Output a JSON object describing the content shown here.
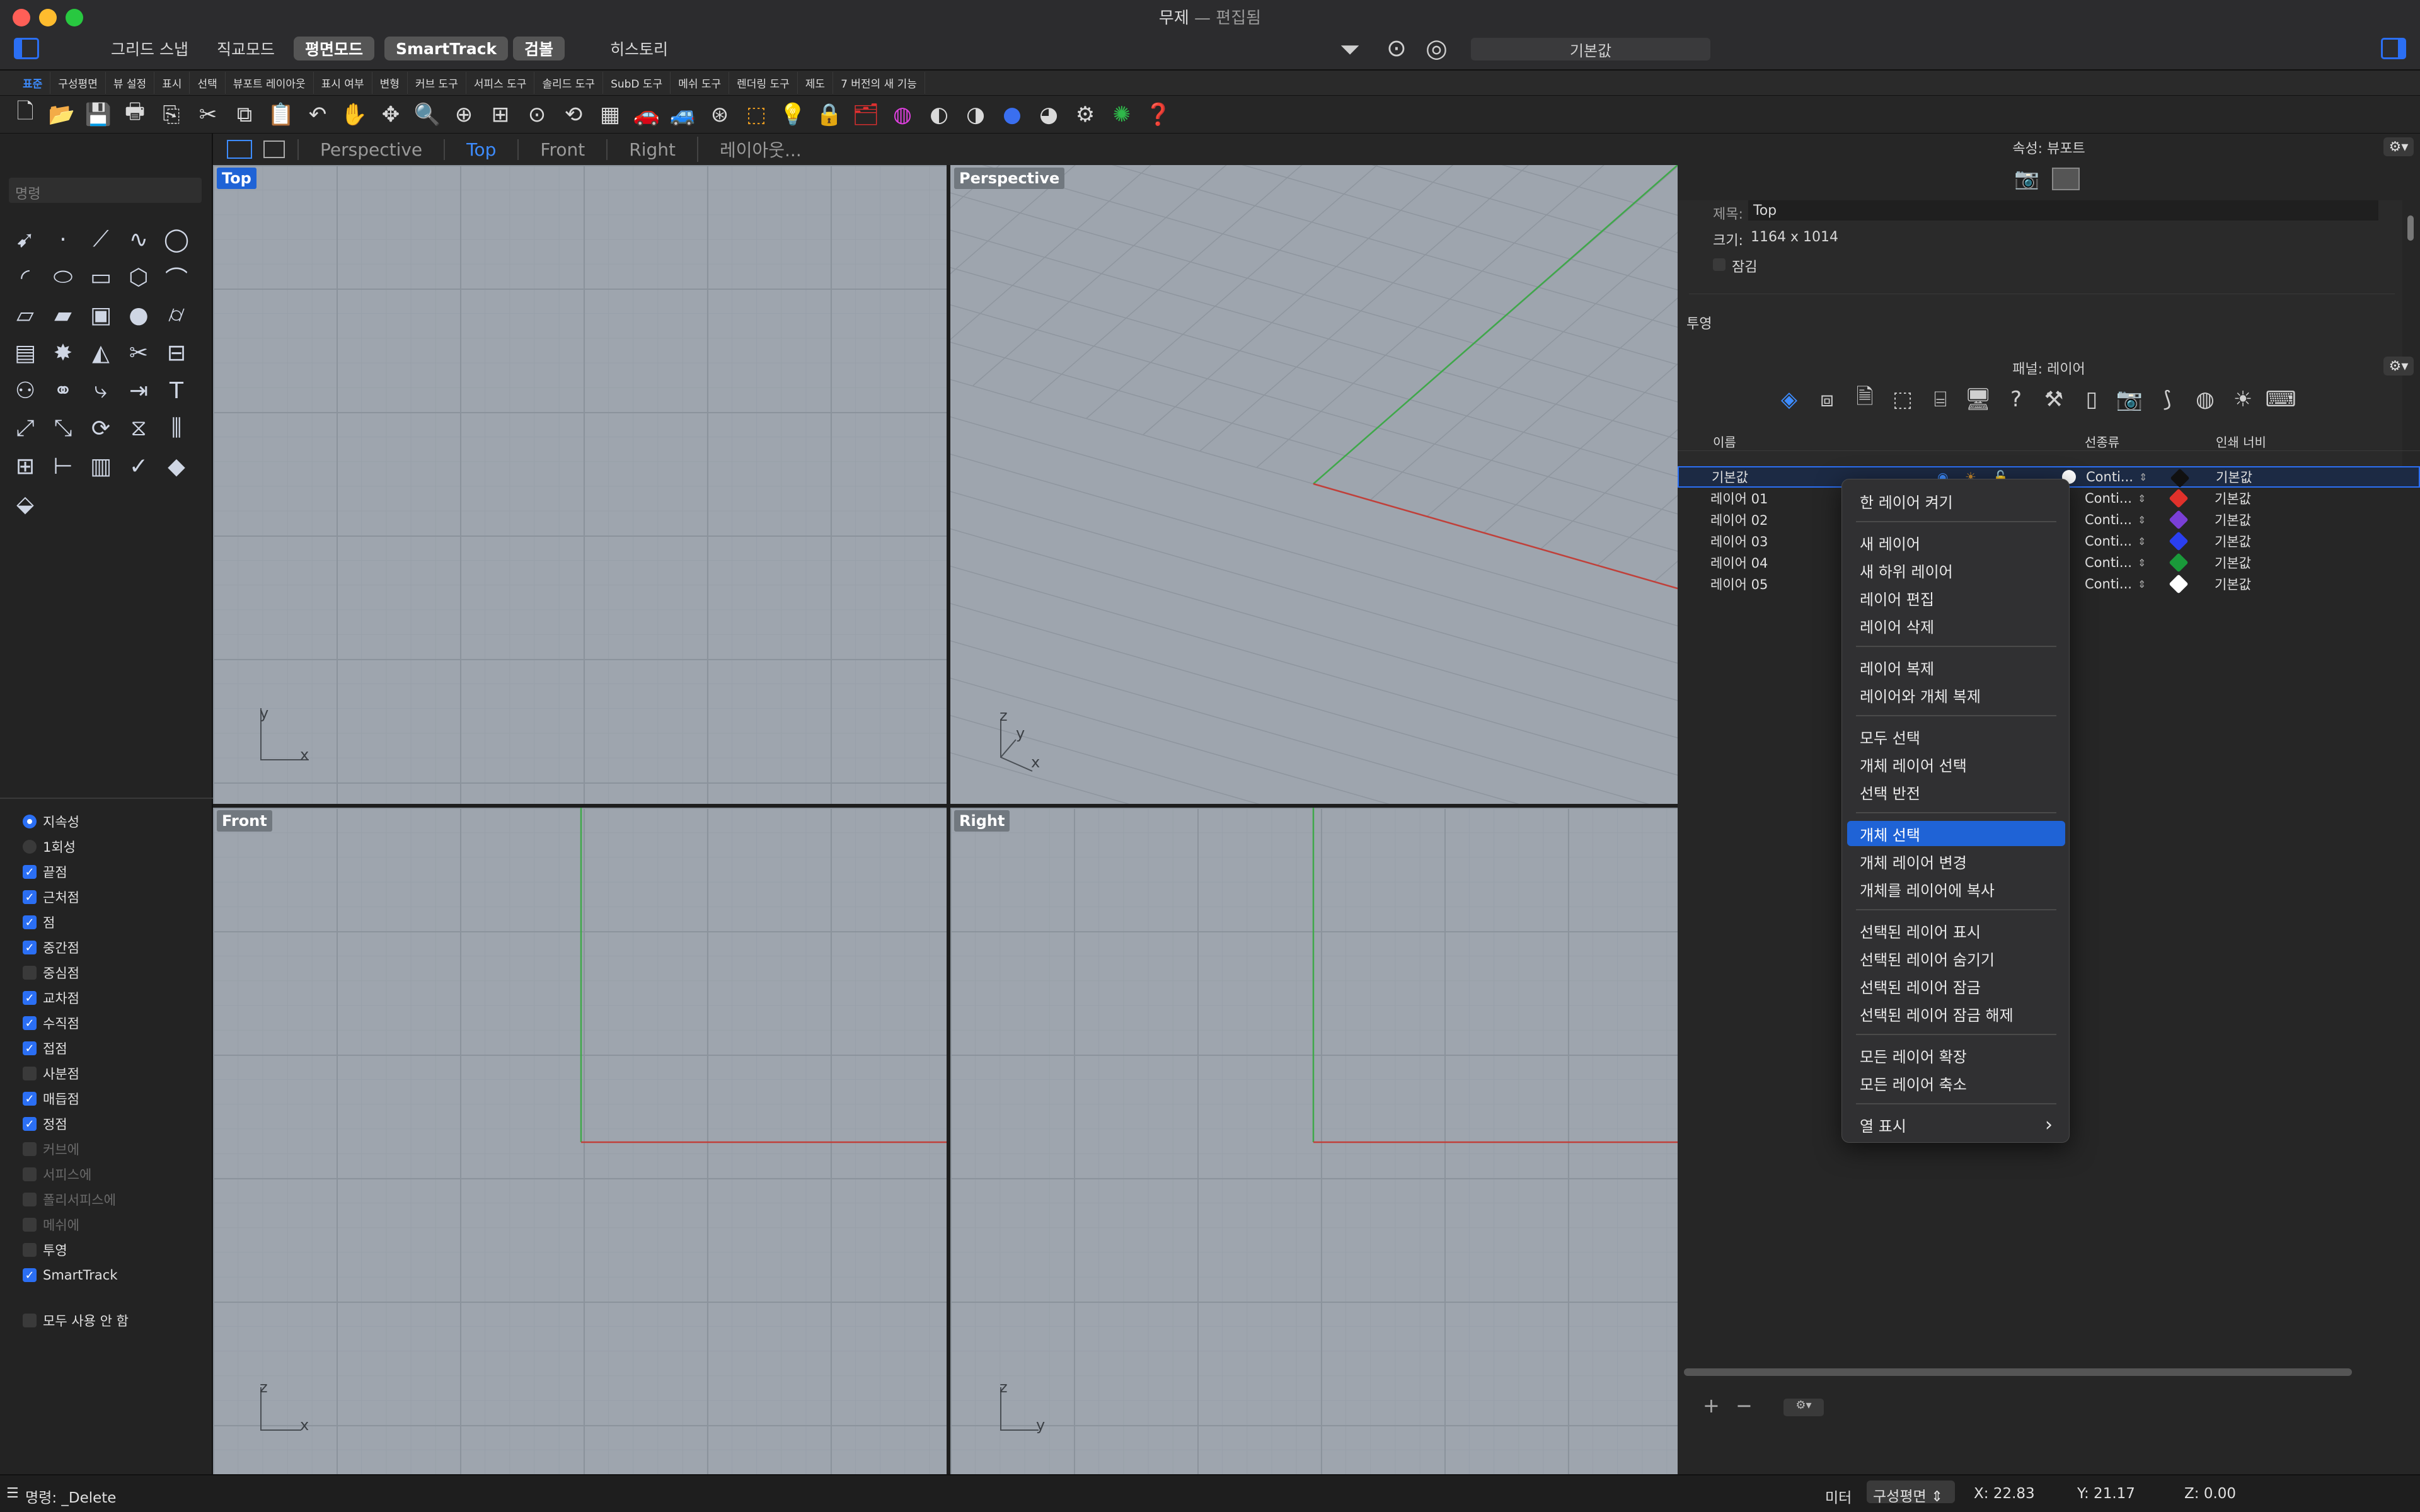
{
  "window": {
    "title": "무제",
    "subtitle": "— 편집됨"
  },
  "modes": [
    "그리드 스냅",
    "직교모드",
    "평면모드",
    "SmartTrack",
    "검볼",
    "히스토리"
  ],
  "cplane_label": "기본값",
  "tabs": [
    "표준",
    "구성평면",
    "뷰 설정",
    "표시",
    "선택",
    "뷰포트 레이아웃",
    "표시 여부",
    "변형",
    "커브 도구",
    "서피스 도구",
    "솔리드 도구",
    "SubD 도구",
    "메쉬 도구",
    "렌더링 도구",
    "제도",
    "7 버전의 새 기능"
  ],
  "viewport_tabs": [
    "Perspective",
    "Top",
    "Front",
    "Right",
    "레이아웃..."
  ],
  "command_placeholder": "명령",
  "viewports": {
    "top": "Top",
    "perspective": "Perspective",
    "front": "Front",
    "right": "Right"
  },
  "axes": {
    "x": "x",
    "y": "y",
    "z": "z"
  },
  "osnap": {
    "persistent": "지속성",
    "once": "1회성",
    "items": [
      {
        "label": "끝점",
        "checked": true
      },
      {
        "label": "근처점",
        "checked": true
      },
      {
        "label": "점",
        "checked": true
      },
      {
        "label": "중간점",
        "checked": true
      },
      {
        "label": "중심점",
        "checked": false
      },
      {
        "label": "교차점",
        "checked": true
      },
      {
        "label": "수직점",
        "checked": true
      },
      {
        "label": "접점",
        "checked": true
      },
      {
        "label": "사분점",
        "checked": false
      },
      {
        "label": "매듭점",
        "checked": true
      },
      {
        "label": "정점",
        "checked": true
      },
      {
        "label": "커브에",
        "checked": false
      },
      {
        "label": "서피스에",
        "checked": false
      },
      {
        "label": "폴리서피스에",
        "checked": false
      },
      {
        "label": "메쉬에",
        "checked": false
      },
      {
        "label": "투영",
        "checked": false
      },
      {
        "label": "SmartTrack",
        "checked": true
      }
    ],
    "disable_all": "모두 사용 안 함"
  },
  "properties": {
    "header": "속성: 뷰포트",
    "title_label": "제목:",
    "title_value": "Top",
    "size_label": "크기:",
    "size_value": "1164 x 1014",
    "lock_label": "잠김",
    "projection_label": "투영"
  },
  "layers_panel": {
    "header": "패널: 레이어",
    "col_name": "이름",
    "col_linetype": "선종류",
    "col_printwidth": "인쇄 너비",
    "rows": [
      {
        "name": "기본값",
        "linetype": "Conti...",
        "color": "#111111",
        "print": "기본값"
      },
      {
        "name": "레이어 01",
        "linetype": "Conti...",
        "color": "#e0312b",
        "print": "기본값"
      },
      {
        "name": "레이어 02",
        "linetype": "Conti...",
        "color": "#7a3fd6",
        "print": "기본값"
      },
      {
        "name": "레이어 03",
        "linetype": "Conti...",
        "color": "#2a3ff0",
        "print": "기본값"
      },
      {
        "name": "레이어 04",
        "linetype": "Conti...",
        "color": "#1a9a3a",
        "print": "기본값"
      },
      {
        "name": "레이어 05",
        "linetype": "Conti...",
        "color": "#ffffff",
        "print": "기본값"
      }
    ]
  },
  "context_menu": {
    "items": [
      "한 레이어 켜기",
      "새 레이어",
      "새 하위 레이어",
      "레이어 편집",
      "레이어 삭제",
      "레이어 복제",
      "레이어와 개체 복제",
      "모두 선택",
      "개체 레이어 선택",
      "선택 반전",
      "개체 선택",
      "개체 레이어 변경",
      "개체를 레이어에 복사",
      "선택된 레이어 표시",
      "선택된 레이어 숨기기",
      "선택된 레이어 잠금",
      "선택된 레이어 잠금 해제",
      "모든 레이어 확장",
      "모든 레이어 축소",
      "열 표시"
    ],
    "highlighted": "개체 선택"
  },
  "status": {
    "command": "명령: _Delete",
    "units": "미터",
    "cplane": "구성평면",
    "x": "X: 22.83",
    "y": "Y: 21.17",
    "z": "Z: 0.00"
  }
}
